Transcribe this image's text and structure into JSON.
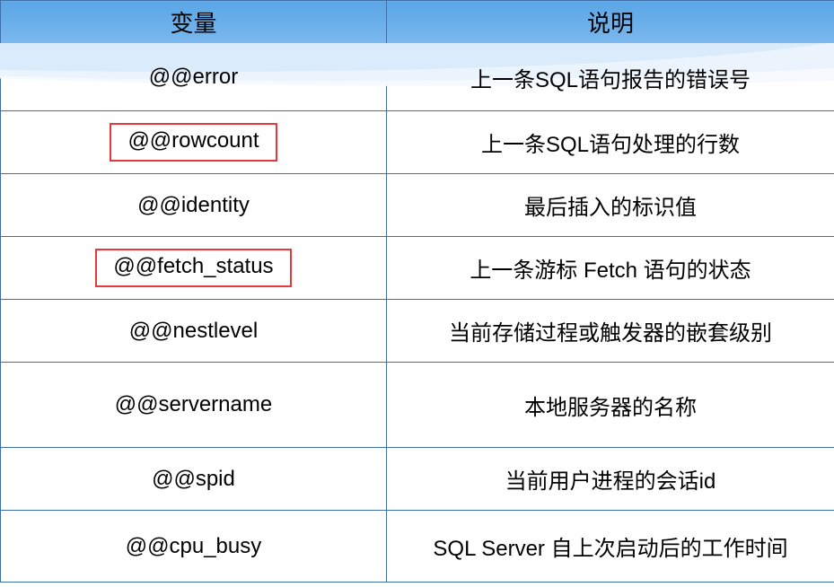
{
  "headers": {
    "variable": "变量",
    "description": "说明"
  },
  "rows": [
    {
      "variable": "@@error",
      "description": "上一条SQL语句报告的错误号",
      "highlight": false
    },
    {
      "variable": "@@rowcount",
      "description": "上一条SQL语句处理的行数",
      "highlight": true
    },
    {
      "variable": "@@identity",
      "description": "最后插入的标识值",
      "highlight": false
    },
    {
      "variable": "@@fetch_status",
      "description": "上一条游标 Fetch 语句的状态",
      "highlight": true
    },
    {
      "variable": "@@nestlevel",
      "description": "当前存储过程或触发器的嵌套级别",
      "highlight": false
    },
    {
      "variable": "@@servername",
      "description": "本地服务器的名称",
      "highlight": false
    },
    {
      "variable": "@@spid",
      "description": "当前用户进程的会话id",
      "highlight": false
    },
    {
      "variable": "@@cpu_busy",
      "description": "SQL Server 自上次启动后的工作时间",
      "highlight": false
    }
  ]
}
